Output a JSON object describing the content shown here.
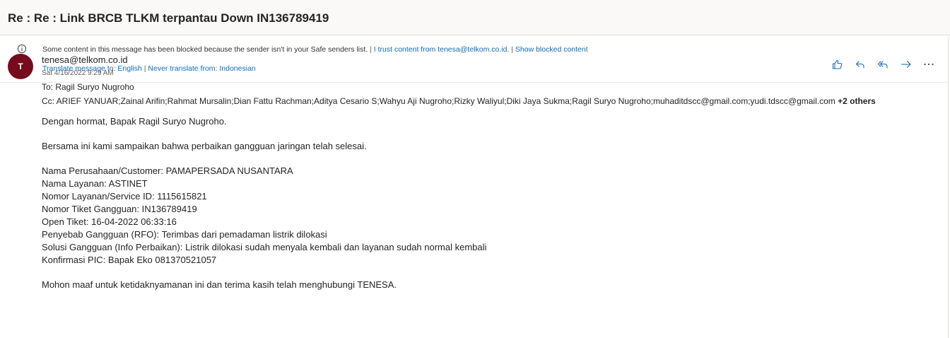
{
  "subject": "Re : Re : Link BRCB TLKM terpantau Down IN136789419",
  "info_bar": {
    "blocked": {
      "icon": "info-icon",
      "message": "Some content in this message has been blocked because the sender isn't in your Safe senders list.",
      "separator1": " | ",
      "trust_link": "I trust content from tenesa@telkom.co.id.",
      "separator2": " | ",
      "show_link": "Show blocked content"
    },
    "translate": {
      "icon": "translate-icon",
      "translate_link": "Translate message to: English",
      "separator": " | ",
      "never_link": "Never translate from: Indonesian"
    }
  },
  "message": {
    "avatar_initial": "T",
    "avatar_color": "#750b1c",
    "sender": "tenesa@telkom.co.id",
    "date": "Sat 4/16/2022 9:29 AM",
    "to": "To: Ragil Suryo Nugroho",
    "cc": "Cc: ARIEF YANUAR;Zainal Arifin;Rahmat Mursalin;Dian Fattu Rachman;Aditya Cesario S;Wahyu Aji Nugroho;Rizky Waliyul;Diki Jaya Sukma;Ragil Suryo Nugroho;muhaditdscc@gmail.com;yudi.tdscc@gmail.com",
    "cc_more": "+2 others",
    "actions": [
      "like-icon",
      "reply-icon",
      "reply-all-icon",
      "forward-icon",
      "more-icon"
    ],
    "accent_color": "#0f6cbd",
    "body": {
      "greeting": "Dengan hormat, Bapak Ragil Suryo Nugroho.",
      "intro": "Bersama ini kami sampaikan bahwa perbaikan gangguan jaringan telah selesai.",
      "details": [
        "Nama Perusahaan/Customer: PAMAPERSADA NUSANTARA",
        "Nama Layanan: ASTINET",
        "Nomor Layanan/Service ID: 1115615821",
        "Nomor Tiket Gangguan: IN136789419",
        "Open Tiket: 16-04-2022 06:33:16",
        "Penyebab Gangguan (RFO): Terimbas dari pemadaman listrik dilokasi",
        "Solusi Gangguan (Info Perbaikan): Listrik dilokasi sudah menyala kembali dan layanan sudah normal kembali",
        "Konfirmasi PIC: Bapak Eko 081370521057"
      ],
      "closing": "Mohon maaf untuk ketidaknyamanan ini dan terima kasih telah menghubungi TENESA."
    }
  }
}
